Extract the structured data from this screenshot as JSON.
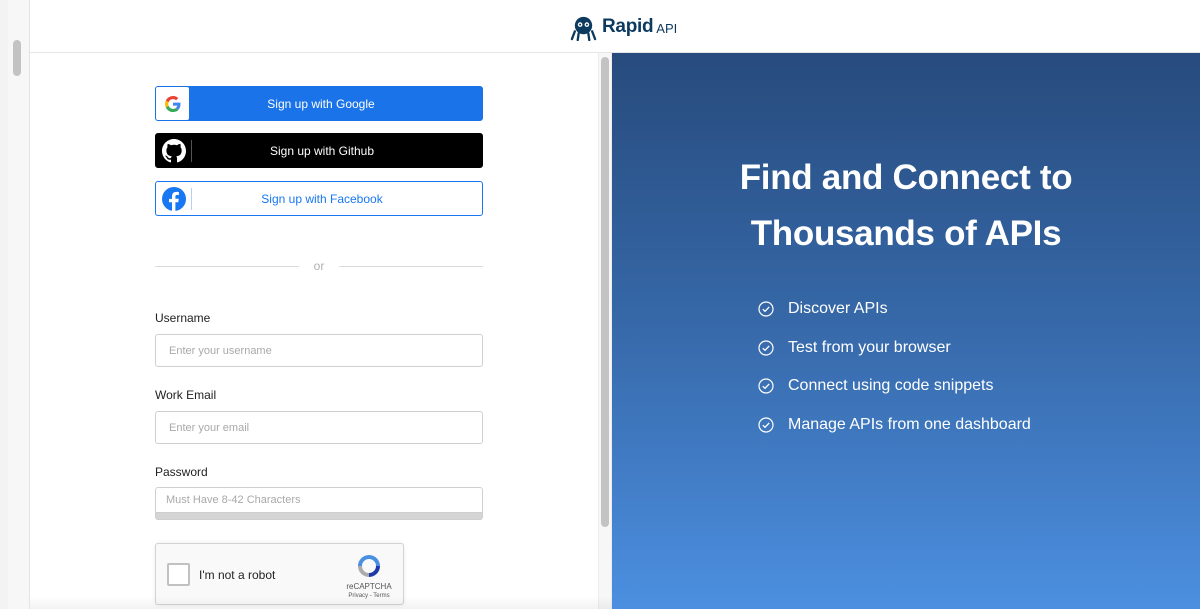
{
  "header": {
    "logo_text": "Rapid",
    "logo_sub": "API"
  },
  "social": {
    "google_label": "Sign up with Google",
    "github_label": "Sign up with Github",
    "facebook_label": "Sign up with Facebook"
  },
  "divider_text": "or",
  "form": {
    "username_label": "Username",
    "username_placeholder": "Enter your username",
    "email_label": "Work Email",
    "email_placeholder": "Enter your email",
    "password_label": "Password",
    "password_placeholder": "Must Have 8-42 Characters"
  },
  "captcha": {
    "label": "I'm not a robot",
    "brand": "reCAPTCHA",
    "terms": "Privacy - Terms"
  },
  "hero": {
    "line1": "Find and Connect to",
    "line2": "Thousands of APIs",
    "features": [
      "Discover APIs",
      "Test from your browser",
      "Connect using code snippets",
      "Manage APIs from one dashboard"
    ]
  },
  "colors": {
    "google": "#1a73e8",
    "facebook": "#1877f2",
    "github": "#000000",
    "logo": "#0d3a5f",
    "gradient_top": "#274b7d",
    "gradient_bottom": "#4c8fe0"
  },
  "icons": [
    "rapidapi-logo-icon",
    "google-icon",
    "github-icon",
    "facebook-icon",
    "recaptcha-icon",
    "check-circle-icon"
  ]
}
